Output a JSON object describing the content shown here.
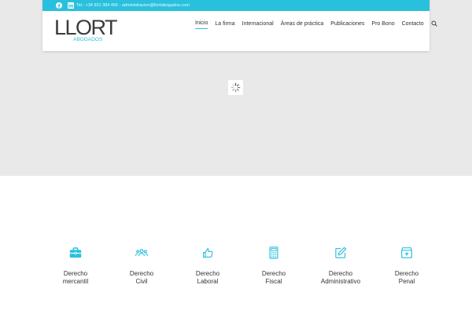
{
  "colors": {
    "accent": "#29c0dd",
    "hero_bg": "#e9e9e9",
    "text": "#333333"
  },
  "topbar": {
    "social": [
      {
        "name": "facebook-icon"
      },
      {
        "name": "linkedin-icon"
      }
    ],
    "contact_text": "Tel.: +34 931 384 455 - administracion@llortabogados.com"
  },
  "logo": {
    "word": "LLORT",
    "sub": "ABOGADOS"
  },
  "nav": {
    "items": [
      "Inicio",
      "La firma",
      "Internacional",
      "Áreas de práctica",
      "Publicaciones",
      "Pro Bono",
      "Contacto"
    ],
    "active": "Inicio",
    "search_icon": "search-icon"
  },
  "loader": {
    "icon": "spinner-icon"
  },
  "services": [
    {
      "line1": "Derecho",
      "line2": "mercantil",
      "icon": "briefcase-icon"
    },
    {
      "line1": "Derecho",
      "line2": "Civil",
      "icon": "people-icon"
    },
    {
      "line1": "Derecho",
      "line2": "Laboral",
      "icon": "thumbs-up-icon"
    },
    {
      "line1": "Derecho",
      "line2": "Fiscal",
      "icon": "calculator-icon"
    },
    {
      "line1": "Derecho",
      "line2": "Administrativo",
      "icon": "edit-icon"
    },
    {
      "line1": "Derecho",
      "line2": "Penal",
      "icon": "medkit-icon"
    }
  ]
}
